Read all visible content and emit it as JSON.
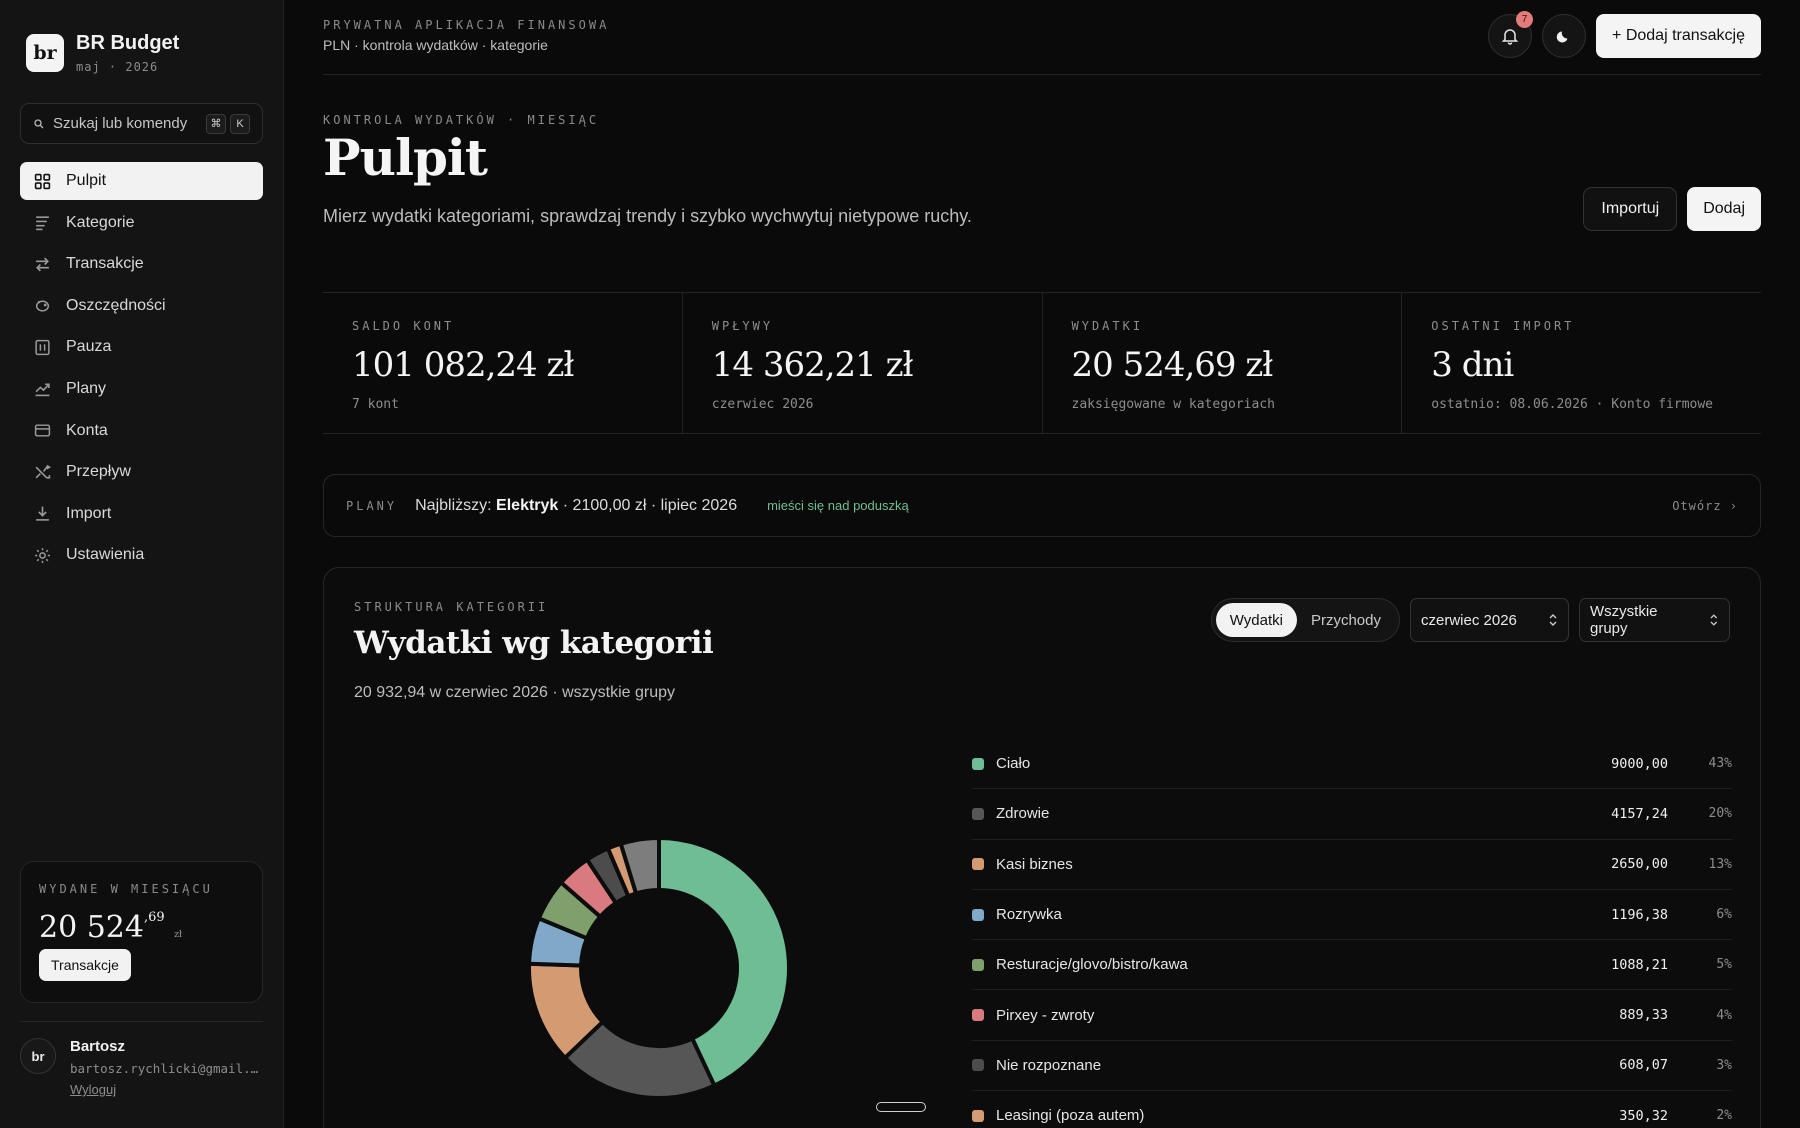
{
  "app": {
    "name": "BR Budget",
    "logo": "br",
    "period": "maj · 2026"
  },
  "search": {
    "placeholder": "Szukaj lub komendy",
    "key1": "⌘",
    "key2": "K"
  },
  "nav": [
    {
      "label": "Pulpit",
      "icon": "grid-icon",
      "active": true
    },
    {
      "label": "Kategorie",
      "icon": "list-icon"
    },
    {
      "label": "Transakcje",
      "icon": "swap-icon"
    },
    {
      "label": "Oszczędności",
      "icon": "piggy-icon"
    },
    {
      "label": "Pauza",
      "icon": "pause-icon"
    },
    {
      "label": "Plany",
      "icon": "trend-icon"
    },
    {
      "label": "Konta",
      "icon": "card-icon"
    },
    {
      "label": "Przepływ",
      "icon": "shuffle-icon"
    },
    {
      "label": "Import",
      "icon": "download-icon"
    },
    {
      "label": "Ustawienia",
      "icon": "gear-icon"
    }
  ],
  "month_card": {
    "label": "WYDANE W MIESIĄCU",
    "whole": "20 524",
    "fraction": ",69",
    "currency": "zł",
    "button": "Transakcje"
  },
  "user": {
    "initials": "br",
    "name": "Bartosz",
    "email": "bartosz.rychlicki@gmail.com",
    "logout": "Wyloguj"
  },
  "topbar": {
    "eyebrow": "PRYWATNA APLIKACJA FINANSOWA",
    "sub": "PLN · kontrola wydatków · kategorie",
    "notifications": "7",
    "add_transaction": "+ Dodaj transakcję"
  },
  "page": {
    "eyebrow": "KONTROLA WYDATKÓW · MIESIĄC",
    "title": "Pulpit",
    "description": "Mierz wydatki kategoriami, sprawdzaj trendy i szybko wychwytuj nietypowe ruchy.",
    "import_label": "Importuj",
    "add_label": "Dodaj"
  },
  "stats": [
    {
      "label": "SALDO KONT",
      "value": "101 082,24 zł",
      "sub": "7 kont"
    },
    {
      "label": "WPŁYWY",
      "value": "14 362,21 zł",
      "sub": "czerwiec 2026"
    },
    {
      "label": "WYDATKI",
      "value": "20 524,69 zł",
      "sub": "zaksięgowane w kategoriach"
    },
    {
      "label": "OSTATNI IMPORT",
      "value": "3 dni",
      "sub": "ostatnio: 08.06.2026 · Konto firmowe"
    }
  ],
  "plans": {
    "label": "PLANY",
    "prefix": "Najbliższy:",
    "name": "Elektryk",
    "details": "· 2100,00 zł · lipiec 2026",
    "note": "mieści się nad poduszką",
    "open": "Otwórz ›"
  },
  "panel": {
    "eyebrow": "STRUKTURA KATEGORII",
    "title": "Wydatki wg kategorii",
    "subtitle": "20 932,94 w czerwiec 2026 · wszystkie grupy",
    "toggle": [
      "Wydatki",
      "Przychody"
    ],
    "month_select": "czerwiec 2026",
    "group_select": "Wszystkie grupy"
  },
  "chart_data": {
    "type": "pie",
    "title": "",
    "donut": true,
    "slices": [
      {
        "label": "Ciało",
        "value": 9000.0,
        "display": "9000,00",
        "percent": "43%",
        "color": "#6fbd95"
      },
      {
        "label": "Zdrowie",
        "value": 4157.24,
        "display": "4157,24",
        "percent": "20%",
        "color": "#565656"
      },
      {
        "label": "Kasi biznes",
        "value": 2650.0,
        "display": "2650,00",
        "percent": "13%",
        "color": "#d49a72"
      },
      {
        "label": "Rozrywka",
        "value": 1196.38,
        "display": "1196,38",
        "percent": "6%",
        "color": "#7fa9c7"
      },
      {
        "label": "Resturacje/glovo/bistro/kawa",
        "value": 1088.21,
        "display": "1088,21",
        "percent": "5%",
        "color": "#7fa06d"
      },
      {
        "label": "Pirxey - zwroty",
        "value": 889.33,
        "display": "889,33",
        "percent": "4%",
        "color": "#d97a7f"
      },
      {
        "label": "Nie rozpoznane",
        "value": 608.07,
        "display": "608,07",
        "percent": "3%",
        "color": "#4c4c4c"
      },
      {
        "label": "Leasingi (poza autem)",
        "value": 350.32,
        "display": "350,32",
        "percent": "2%",
        "color": "#d49a72"
      }
    ],
    "remainder": {
      "value": 993.39,
      "color": "#7d7d7d"
    }
  }
}
